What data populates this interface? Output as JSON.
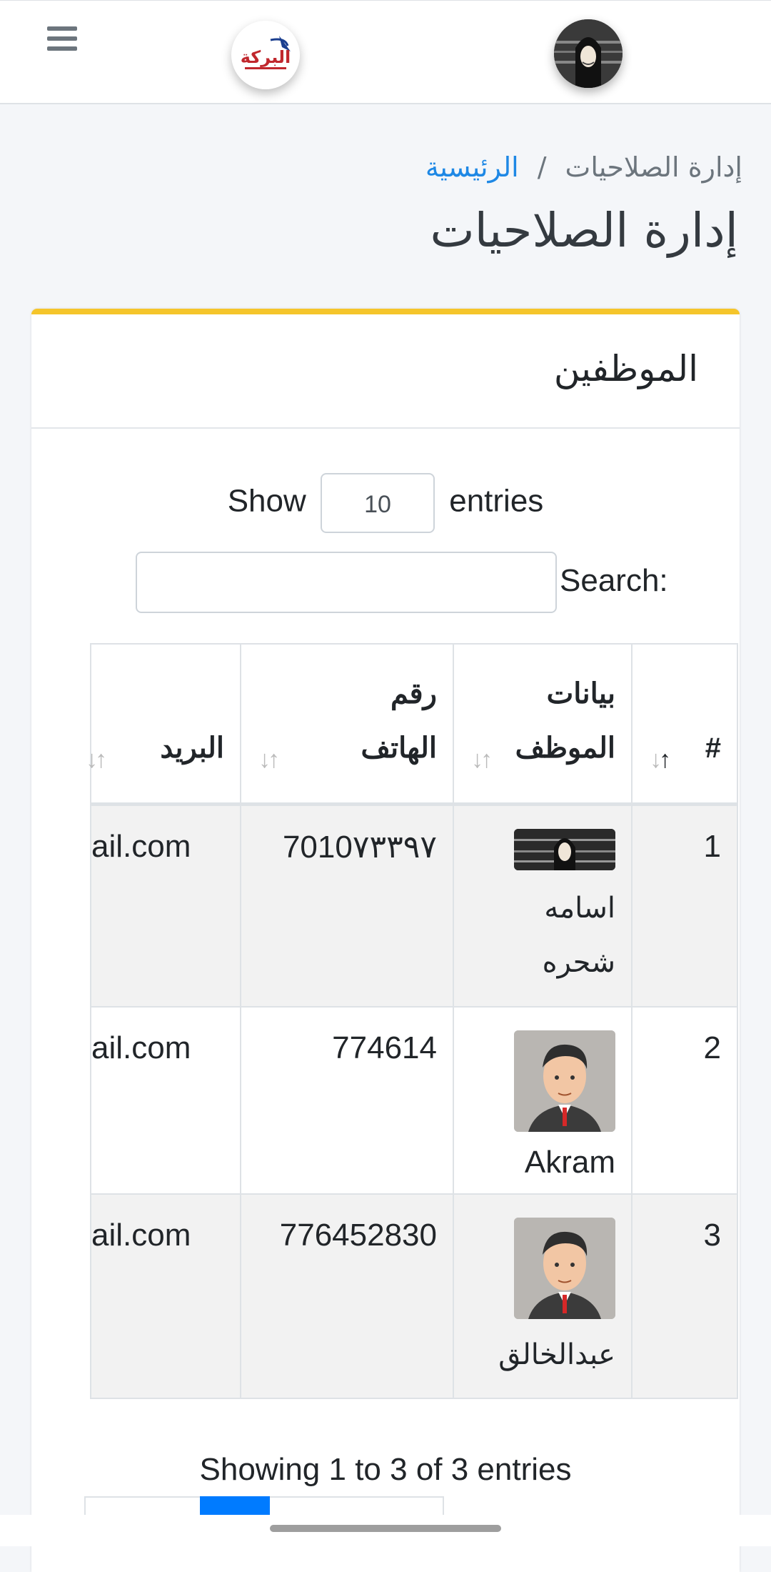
{
  "header": {
    "menu_icon": "hamburger-icon",
    "logo_text": "البركة",
    "avatar": "user-avatar"
  },
  "breadcrumb": {
    "home": "الرئيسية",
    "separator": "/",
    "current": "إدارة الصلاحيات"
  },
  "page_title": "إدارة الصلاحيات",
  "card": {
    "accent_color": "#f5c52b",
    "title": "الموظفين"
  },
  "length": {
    "show": "Show",
    "value": "10",
    "entries": "entries"
  },
  "search": {
    "label": "Search:",
    "value": ""
  },
  "table": {
    "columns": [
      "#",
      "بيانات الموظف",
      "رقم الهاتف",
      "البريد"
    ],
    "rows": [
      {
        "num": "1",
        "name": "اسامه شحره",
        "phone": "7010٧٣٣٩٧",
        "email": "ail.com"
      },
      {
        "num": "2",
        "name": "Akram",
        "phone": "774614",
        "email": "ail.com"
      },
      {
        "num": "3",
        "name": "عبدالخالق",
        "phone": "776452830",
        "email": "ail.com"
      }
    ]
  },
  "info": "Showing 1 to 3 of 3 entries",
  "colors": {
    "link": "#1e88e5",
    "pager_active": "#007bff"
  }
}
